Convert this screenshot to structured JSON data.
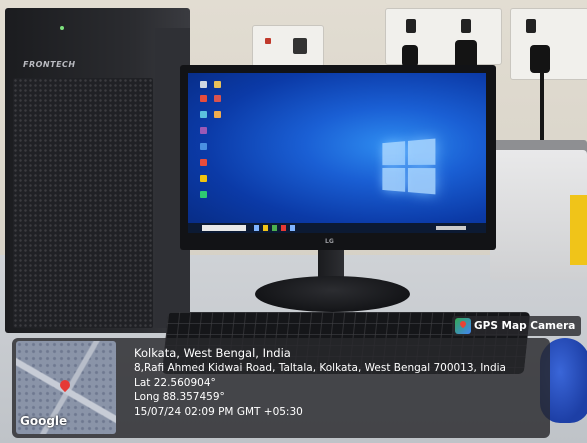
{
  "tower": {
    "brand": "FRONTECH"
  },
  "monitor": {
    "brand": "LG"
  },
  "overlay": {
    "tag": "GPS Map Camera",
    "map_label": "Google",
    "location_title": "Kolkata, West Bengal, India",
    "address": "8,Rafi Ahmed Kidwai Road, Taltala, Kolkata, West Bengal 700013, India",
    "latitude": "Lat 22.560904°",
    "longitude": "Long 88.357459°",
    "datetime": "15/07/24 02:09 PM GMT +05:30"
  }
}
